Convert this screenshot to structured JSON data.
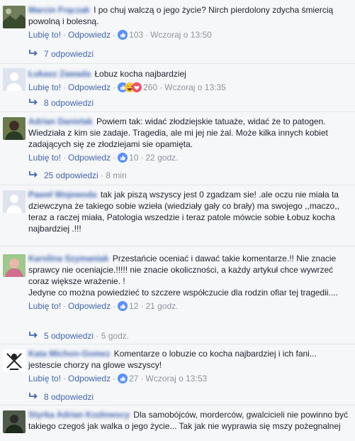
{
  "comments": [
    {
      "author": "Marcin Frączak",
      "text": "I po chuj walczą o jego życie? Nirch pierdolony zdycha śmiercią powolną i bolesną.",
      "like": "Lubię to!",
      "reply": "Odpowiedz",
      "reaction_count": "103",
      "time": "Wczoraj o 13:50",
      "replies": "7 odpowiedzi",
      "replies_time": ""
    },
    {
      "author": "Łukasz Zawada",
      "text": "Łobuz kocha najbardziej",
      "like": "Lubię to!",
      "reply": "Odpowiedz",
      "reaction_count": "260",
      "time": "Wczoraj o 13:35",
      "replies": "8 odpowiedzi",
      "replies_time": ""
    },
    {
      "author": "Adrian Danielak",
      "text": "Powiem tak: widać złodziejskie tatuaże, widać że to patogen. Wiedziała z kim sie zadaje. Tragedia, ale mi jej nie żal. Może kilka innych kobiet zadających się ze złodziejami sie opamięta.",
      "like": "Lubię to!",
      "reply": "Odpowiedz",
      "reaction_count": "10",
      "time": "22 godz.",
      "replies": "25 odpowiedzi",
      "replies_time": "8 min"
    },
    {
      "author": "Paweł Wojewoda",
      "text": "tak jak piszą wszyscy jest 0 zgadzam sie! .ale oczu nie miała ta dziewczyna że takiego sobie wzieła (wiedziały gały co brały) ma swojego ,,maczo,, teraz a raczej miała, Patologia wszedzie i teraz patole mówcie sobie Łobuz kocha najbardziej .!!!",
      "like": "",
      "reply": "",
      "reaction_count": "",
      "time": "",
      "replies": "",
      "replies_time": ""
    },
    {
      "author": "Karolina Szymaniak",
      "text": "Przestańcie oceniać i dawać takie komentarze.!! Nie znacie sprawcy nie oceniajcie.!!!!! nie znacie okoliczności, a każdy artykuł chce wywrzeć coraz większe wrażenie. !",
      "text2": "Jedyne co można powiedzieć to szczere współczucie dla rodzin ofiar tej tragedii....",
      "like": "Lubię to!",
      "reply": "Odpowiedz",
      "reaction_count": "12",
      "time": "21 godz.",
      "replies": "5 odpowiedzi",
      "replies_time": "5 godz."
    },
    {
      "author": "Kata Michon-Gomez",
      "text": "Komentarze o lobuzie co kocha najbardziej i ich fani... jestescie chorzy na glowe wszyscy!",
      "like": "Lubię to!",
      "reply": "Odpowiedz",
      "reaction_count": "27",
      "time": "Wczoraj o 13:53",
      "replies": "8 odpowiedzi",
      "replies_time": ""
    },
    {
      "author": "Styrka Adrian Kozłowscy",
      "text": "Dla samobójców, morderców, gwalcicieli nie powinno być takiego czegoś jak walka o jego życie... Tak jak nie wyprawia się mszy pożegnalnej",
      "like": "",
      "reply": "",
      "reaction_count": "",
      "time": "",
      "replies": "",
      "replies_time": ""
    }
  ],
  "colors": {
    "link": "#4267b2",
    "meta": "#90949c",
    "text": "#1d2129",
    "background": "#f6f7f9",
    "like_blue": "#5890ff",
    "love_red": "#f25268",
    "haha_yellow": "#fcc935"
  },
  "icons": {
    "like": "thumbs-up-reaction-icon",
    "haha": "haha-reaction-icon",
    "love": "love-reaction-icon",
    "reply_arrow": "reply-arrow-icon"
  }
}
